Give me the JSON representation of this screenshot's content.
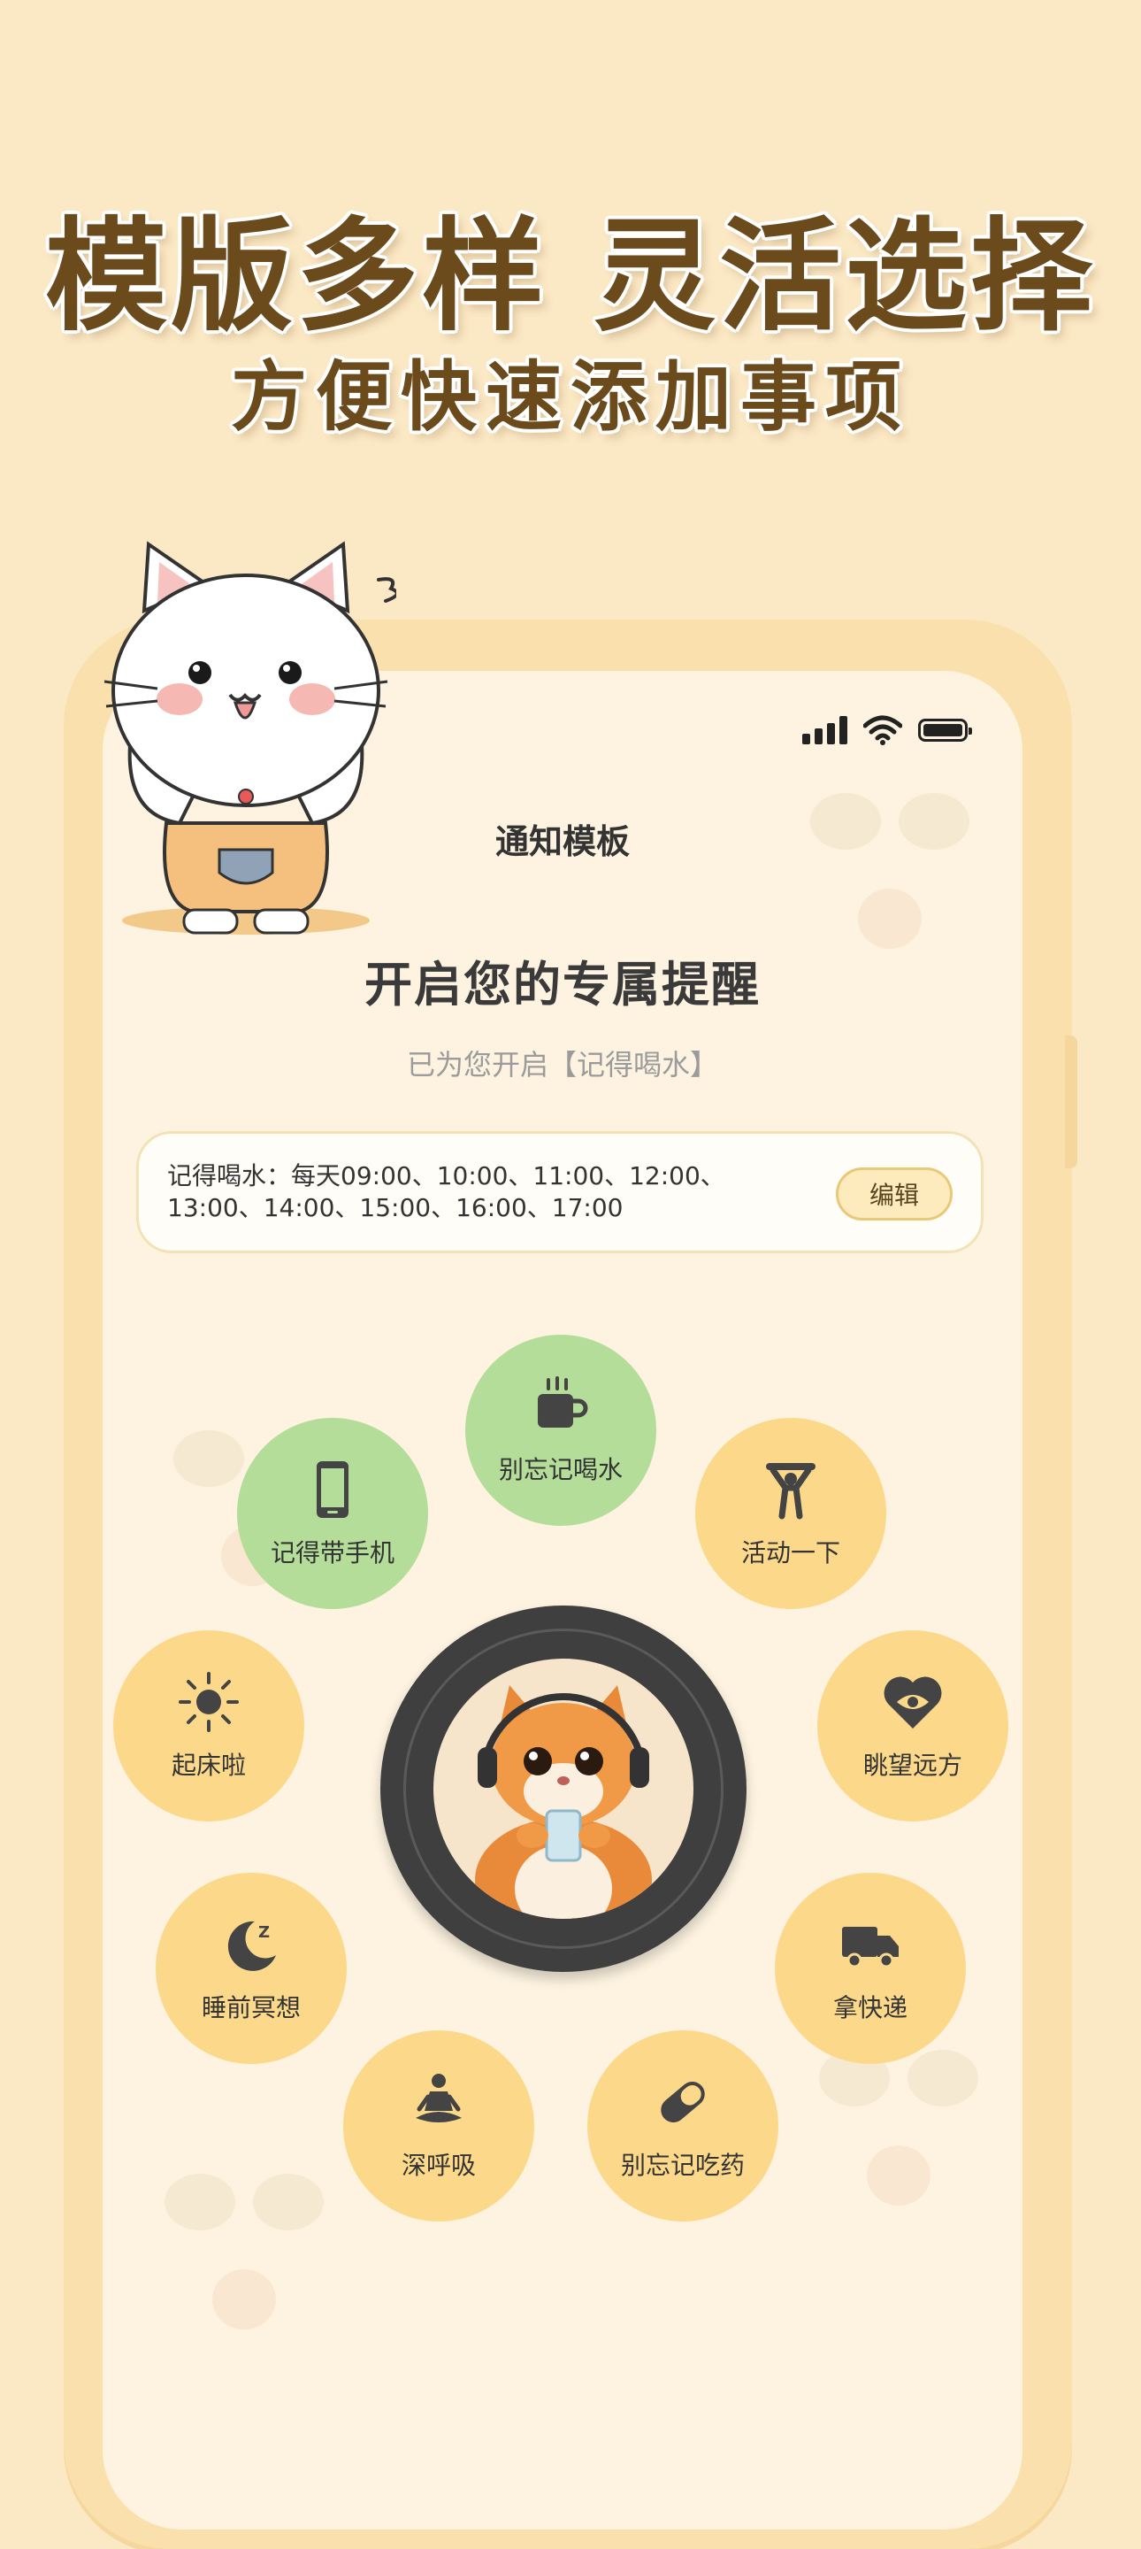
{
  "headline": {
    "title": "模版多样 灵活选择",
    "subtitle": "方便快速添加事项"
  },
  "screen": {
    "title": "通知模板",
    "main_title": "开启您的专属提醒",
    "subtitle": "已为您开启【记得喝水】",
    "reminder": {
      "text": "记得喝水：每天09:00、10:00、11:00、12:00、13:00、14:00、15:00、16:00、17:00",
      "edit_label": "编辑"
    },
    "templates": [
      {
        "label": "别忘记喝水",
        "icon": "cup-icon",
        "color": "#b5dd9a"
      },
      {
        "label": "记得带手机",
        "icon": "phone-icon",
        "color": "#b5dd9a"
      },
      {
        "label": "活动一下",
        "icon": "exercise-icon",
        "color": "#fcd98a"
      },
      {
        "label": "起床啦",
        "icon": "sun-icon",
        "color": "#fcd98a"
      },
      {
        "label": "眺望远方",
        "icon": "eye-icon",
        "color": "#fcd98a"
      },
      {
        "label": "睡前冥想",
        "icon": "moon-icon",
        "color": "#fcd98a"
      },
      {
        "label": "拿快递",
        "icon": "truck-icon",
        "color": "#fcd98a"
      },
      {
        "label": "深呼吸",
        "icon": "meditation-icon",
        "color": "#fcd98a"
      },
      {
        "label": "别忘记吃药",
        "icon": "pill-icon",
        "color": "#fcd98a"
      }
    ]
  },
  "colors": {
    "background": "#fbe8c4",
    "headline": "#6b4a1c",
    "green": "#b5dd9a",
    "yellow": "#fcd98a"
  }
}
